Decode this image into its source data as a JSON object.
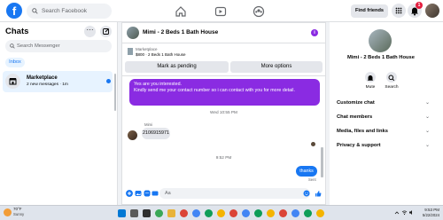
{
  "header": {
    "logo": "f",
    "search_placeholder": "Search Facebook",
    "find_friends": "Find friends",
    "notification_count": "1"
  },
  "sidebar": {
    "title": "Chats",
    "more_label": "···",
    "search_placeholder": "Search Messenger",
    "tab": "Inbox",
    "conversation": {
      "name": "Marketplace",
      "preview": "2 new messages · 1m"
    }
  },
  "chat": {
    "contact_name": "Mimi - 2 Beds 1 Bath House",
    "info_label": "i",
    "listing": {
      "source": "Marketplace",
      "price_line": "$800 · 2 Beds 1 Bath House",
      "mark_pending": "Mark as pending",
      "more_options": "More options"
    },
    "messages": {
      "outgoing_1": "Yes are you interested.\nKindly send me your contact number so i can contact with you for more detail.",
      "timestamp_1": "Wed 10:55 PM",
      "sender_name": "Mimi",
      "incoming_1": "2106915971",
      "timestamp_2": "9:52 PM",
      "outgoing_2": "thanks",
      "status": "Sent"
    },
    "composer_placeholder": "Aa"
  },
  "info_panel": {
    "name": "Mimi - 2 Beds 1 Bath House",
    "actions": [
      {
        "label": "Mute"
      },
      {
        "label": "Search"
      }
    ],
    "sections": [
      {
        "label": "Customize chat"
      },
      {
        "label": "Chat members"
      },
      {
        "label": "Media, files and links"
      },
      {
        "label": "Privacy & support"
      }
    ]
  },
  "taskbar": {
    "weather_temp": "70°F",
    "weather_desc": "Sunny",
    "time": "9:53 PM",
    "date": "5/22/2024"
  },
  "colors": {
    "brand": "#1877f2",
    "outgoing_bubble": "#8a2be2",
    "notification_badge": "#e41e3f"
  }
}
